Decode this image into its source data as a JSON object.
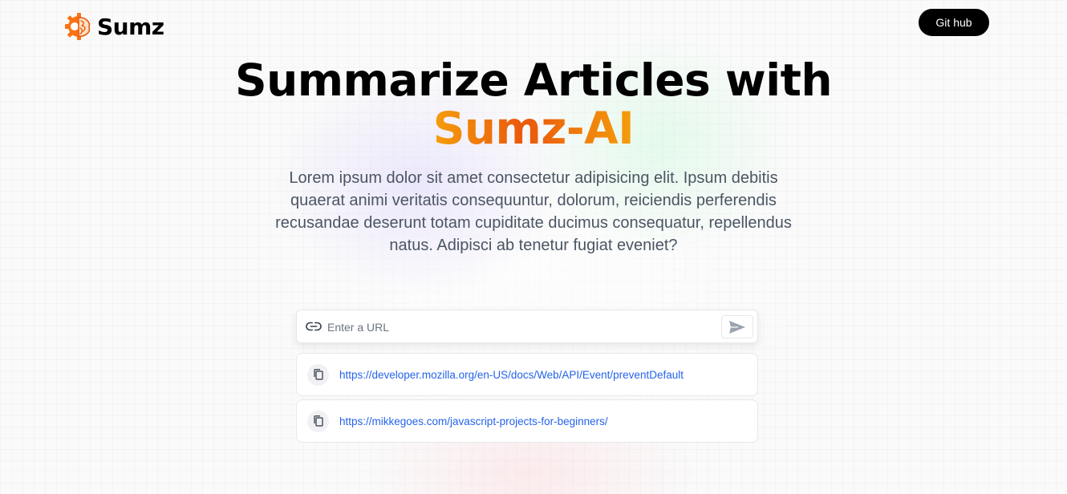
{
  "nav": {
    "brand": "Sumz",
    "github_label": "Git hub"
  },
  "hero": {
    "title_line1": "Summarize Articles with",
    "title_accent": "Sumz-AI",
    "description": "Lorem ipsum dolor sit amet consectetur adipisicing elit. Ipsum debitis quaerat animi veritatis consequuntur, dolorum, reiciendis perferendis recusandae deserunt totam cupiditate ducimus consequatur, repellendus natus. Adipisci ab tenetur fugiat eveniet?"
  },
  "search": {
    "placeholder": "Enter a URL",
    "value": ""
  },
  "history": [
    {
      "url": "https://developer.mozilla.org/en-US/docs/Web/API/Event/preventDefault"
    },
    {
      "url": "https://mikkegoes.com/javascript-projects-for-beginners/"
    }
  ],
  "colors": {
    "accent_start": "#f59e0b",
    "accent_mid": "#ea580c",
    "link": "#2563eb",
    "button_bg": "#000000"
  },
  "icons": {
    "logo": "brain-gear-icon",
    "link": "link-icon",
    "submit": "send-icon",
    "copy": "copy-icon"
  }
}
